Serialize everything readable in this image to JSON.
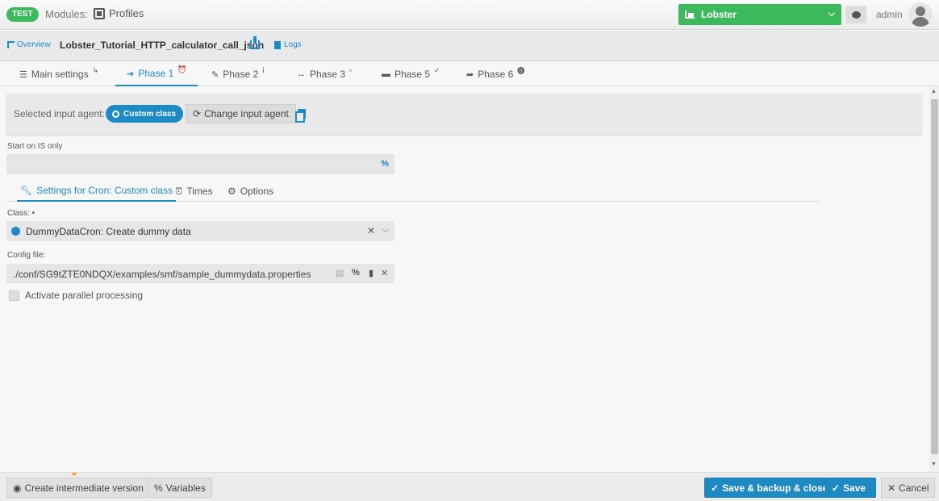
{
  "header": {
    "env_badge": "TEST",
    "modules_label": "Modules:",
    "section": "Profiles",
    "instance": "Lobster",
    "user": "admin"
  },
  "subbar": {
    "overview": "Overview",
    "profile_name": "Lobster_Tutorial_HTTP_calculator_call_json",
    "logs": "Logs"
  },
  "phase_tabs": [
    {
      "label": "Main settings",
      "suffix": "↳"
    },
    {
      "label": "Phase 1",
      "suffix": "⏰"
    },
    {
      "label": "Phase 2",
      "suffix": "ⅰ"
    },
    {
      "label": "Phase 3",
      "suffix": "▫"
    },
    {
      "label": "Phase 5",
      "suffix": "✓"
    },
    {
      "label": "Phase 6",
      "suffix": "⓿"
    }
  ],
  "agent": {
    "label": "Selected input agent:",
    "pill": "Custom class",
    "change_button": "Change input agent"
  },
  "start_on_is": {
    "label": "Start on IS only",
    "value": ""
  },
  "settings_tabs": [
    {
      "label": "Settings for Cron: Custom class"
    },
    {
      "label": "Times"
    },
    {
      "label": "Options"
    }
  ],
  "class_field": {
    "label": "Class: •",
    "value": "DummyDataCron: Create dummy data"
  },
  "config_field": {
    "label": "Config file:",
    "value": "./conf/SG9tZTE0NDQX/examples/smf/sample_dummydata.properties"
  },
  "parallel": {
    "label": "Activate parallel processing",
    "checked": false
  },
  "footer": {
    "intermediate": "Create intermediate version",
    "variables": "Variables",
    "save_backup_close": "Save & backup & close",
    "save": "Save",
    "cancel": "Cancel"
  },
  "colors": {
    "accent": "#1e8ac4",
    "env_green": "#3cb95c"
  }
}
